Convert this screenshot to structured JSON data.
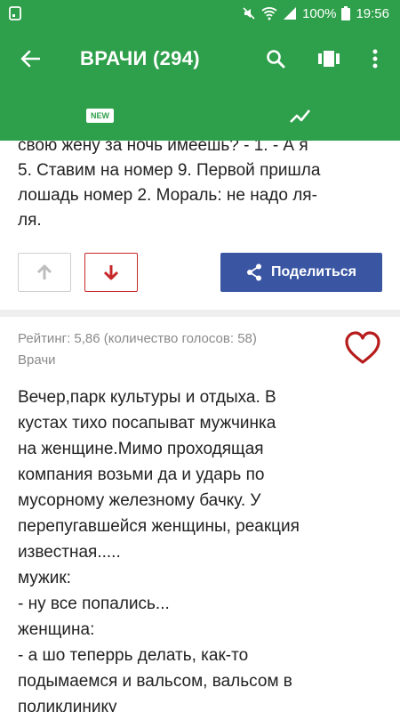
{
  "status_bar": {
    "battery": "100%",
    "time": "19:56"
  },
  "app_bar": {
    "title": "ВРАЧИ (294)"
  },
  "tabs": {
    "new_label": "NEW"
  },
  "post1": {
    "lines": [
      "свою жену за ночь имеешь? - 1. - А я",
      "5. Ставим на номер 9. Первой пришла",
      "лошадь номер 2. Мораль: не надо ля-",
      "ля."
    ],
    "share_label": "Поделиться"
  },
  "post2": {
    "rating": "Рейтинг: 5,86 (количество голосов: 58)",
    "category": "Врачи",
    "lines": [
      "Вечер,парк культуры и отдыха. В",
      "кустах тихо посапыват мужчинка",
      "на женщине.Мимо проходящая",
      "компания возьми да и ударь по",
      "мусорному железному бачку. У",
      "перепугавшейся женщины, реакция",
      "известная.....",
      "мужик:",
      "- ну все попались...",
      "женщина:",
      "- а шо теперрь делать, как-то",
      "подымаемся и вальсом, вальсом в",
      "поликлинику"
    ]
  }
}
